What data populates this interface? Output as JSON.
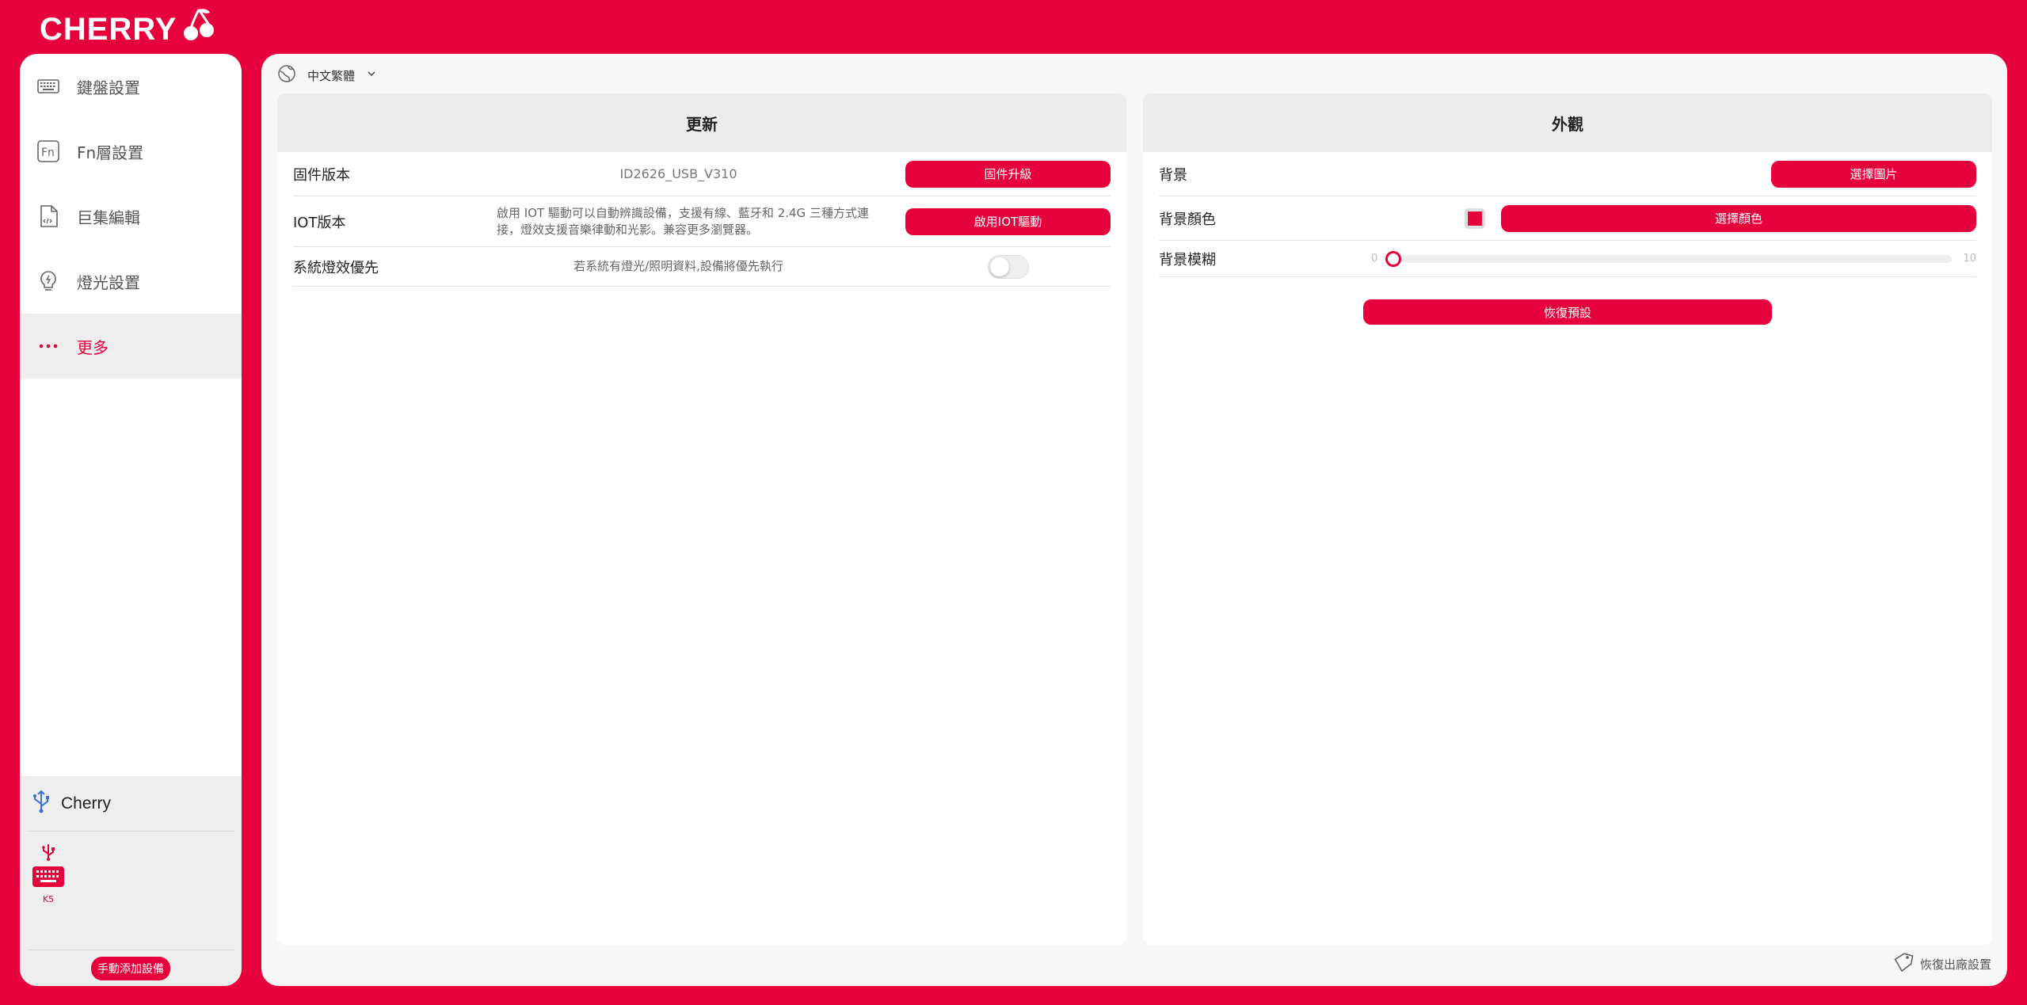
{
  "brand": {
    "name": "CHERRY",
    "accent": "#E6003C"
  },
  "sidebar": {
    "items": [
      {
        "label": "鍵盤設置",
        "icon": "keyboard-icon"
      },
      {
        "label": "Fn層設置",
        "icon": "fn-icon"
      },
      {
        "label": "巨集編輯",
        "icon": "macro-file-icon"
      },
      {
        "label": "燈光設置",
        "icon": "light-bulb-icon"
      },
      {
        "label": "更多",
        "icon": "more-dots-icon",
        "active": true
      }
    ],
    "device_group": "Cherry",
    "device": {
      "name": "K5",
      "connection_icon": "usb-icon"
    },
    "add_device_label": "手動添加設備"
  },
  "language": {
    "selected": "中文繁體"
  },
  "update_card": {
    "title": "更新",
    "firmware": {
      "label": "固件版本",
      "value": "ID2626_USB_V310",
      "button": "固件升級"
    },
    "iot": {
      "label": "IOT版本",
      "description_line1": "啟用 IOT 驅動可以自動辨識設備，支援有線、藍牙和 2.4G 三種方式連",
      "description_line2": "接，燈效支援音樂律動和光影。兼容更多瀏覽器。",
      "button": "啟用IOT驅動"
    },
    "light_priority": {
      "label": "系統燈效優先",
      "description": "若系統有燈光/照明資料,設備將優先執行",
      "enabled": false
    }
  },
  "appearance_card": {
    "title": "外觀",
    "background": {
      "label": "背景",
      "button": "選擇圖片"
    },
    "background_color": {
      "label": "背景顏色",
      "color": "#E6003C",
      "button": "選擇顏色"
    },
    "background_blur": {
      "label": "背景模糊",
      "min": "0",
      "max": "10",
      "value": 0
    },
    "reset_button": "恢復預設"
  },
  "factory_reset_label": "恢復出廠設置"
}
